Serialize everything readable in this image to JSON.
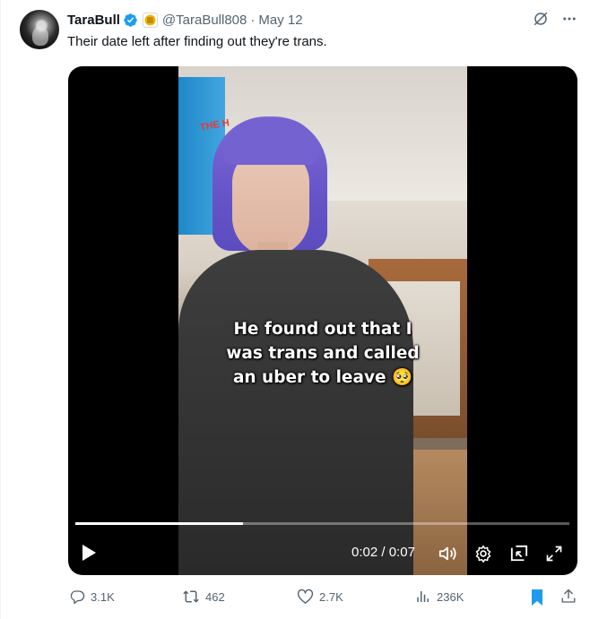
{
  "author": {
    "name": "TaraBull",
    "handle": "@TaraBull808",
    "separator": "·",
    "date": "May 12"
  },
  "tweet": {
    "text": "Their date left after finding out they're trans."
  },
  "video": {
    "caption_lines": [
      "He found out that I",
      "was trans and called",
      "an uber to leave 🥺"
    ],
    "time_current": "0:02",
    "time_separator": "/",
    "time_total": "0:07",
    "progress_fraction": 0.34,
    "background_sign_text": "THE H"
  },
  "actions": {
    "replies": "3.1K",
    "reposts": "462",
    "likes": "2.7K",
    "views": "236K"
  },
  "colors": {
    "accent": "#1d9bf0",
    "secondary_text": "#536471",
    "primary_text": "#0f1419"
  },
  "icons": [
    "verified-badge-icon",
    "affiliate-badge-icon",
    "grok-icon",
    "more-icon",
    "play-icon",
    "volume-icon",
    "settings-icon",
    "pip-icon",
    "fullscreen-icon",
    "reply-icon",
    "repost-icon",
    "like-icon",
    "views-icon",
    "bookmark-icon",
    "share-icon"
  ]
}
